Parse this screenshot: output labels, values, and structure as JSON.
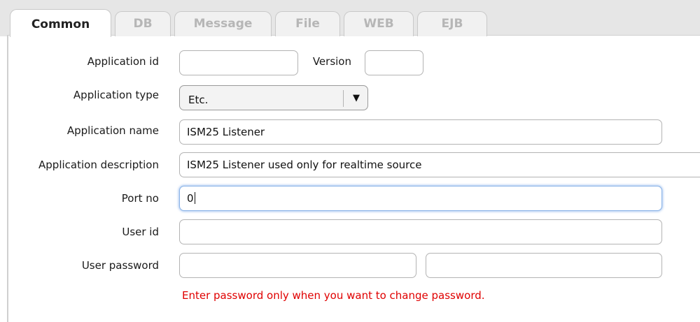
{
  "tabs": [
    {
      "label": "Common",
      "active": true
    },
    {
      "label": "DB"
    },
    {
      "label": "Message"
    },
    {
      "label": "File"
    },
    {
      "label": "WEB"
    },
    {
      "label": "EJB"
    }
  ],
  "form": {
    "application_id": {
      "label": "Application id",
      "value": ""
    },
    "version": {
      "label": "Version",
      "value": ""
    },
    "application_type": {
      "label": "Application type",
      "value": "Etc.",
      "arrow_icon": "▼"
    },
    "application_name": {
      "label": "Application name",
      "value": "ISM25 Listener"
    },
    "application_description": {
      "label": "Application description",
      "value": "ISM25 Listener used only for realtime source"
    },
    "port_no": {
      "label": "Port no",
      "value": "0"
    },
    "user_id": {
      "label": "User id",
      "value": ""
    },
    "user_password": {
      "label": "User password",
      "value": "",
      "confirm_value": ""
    }
  },
  "password_hint": "Enter password only when you want to change password.",
  "colors": {
    "hint": "#e00000",
    "focus_ring": "#8bb4e8"
  }
}
